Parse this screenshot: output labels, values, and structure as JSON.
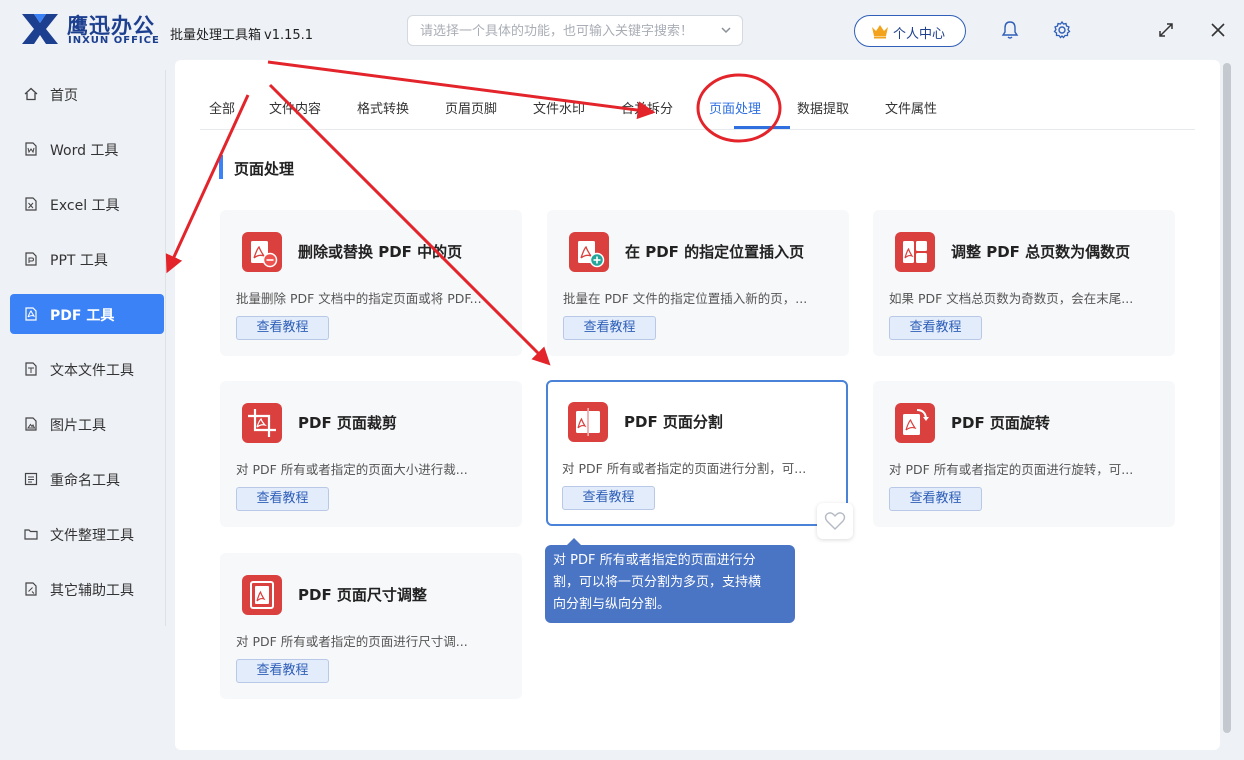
{
  "brand": {
    "name_cn": "鹰迅办公",
    "name_en": "INXUN OFFICE"
  },
  "app": {
    "title": "批量处理工具箱",
    "version": "v1.15.1"
  },
  "search": {
    "placeholder": "请选择一个具体的功能，也可输入关键字搜索！"
  },
  "header": {
    "user_center": "个人中心"
  },
  "sidebar": {
    "items": [
      {
        "label": "首页",
        "icon": "home-icon"
      },
      {
        "label": "Word 工具",
        "icon": "word-file-icon"
      },
      {
        "label": "Excel 工具",
        "icon": "excel-file-icon"
      },
      {
        "label": "PPT 工具",
        "icon": "ppt-file-icon"
      },
      {
        "label": "PDF 工具",
        "icon": "pdf-file-icon",
        "active": true
      },
      {
        "label": "文本文件工具",
        "icon": "text-file-icon"
      },
      {
        "label": "图片工具",
        "icon": "image-file-icon"
      },
      {
        "label": "重命名工具",
        "icon": "rename-icon"
      },
      {
        "label": "文件整理工具",
        "icon": "folder-icon"
      },
      {
        "label": "其它辅助工具",
        "icon": "tools-icon"
      }
    ]
  },
  "tabs": [
    {
      "label": "全部"
    },
    {
      "label": "文件内容"
    },
    {
      "label": "格式转换"
    },
    {
      "label": "页眉页脚"
    },
    {
      "label": "文件水印"
    },
    {
      "label": "合并拆分"
    },
    {
      "label": "页面处理",
      "active": true
    },
    {
      "label": "数据提取"
    },
    {
      "label": "文件属性"
    }
  ],
  "section": {
    "title": "页面处理"
  },
  "cards": [
    {
      "title": "删除或替换 PDF 中的页",
      "desc": "批量删除 PDF 文档中的指定页面或将 PDF...",
      "button": "查看教程"
    },
    {
      "title": "在 PDF 的指定位置插入页",
      "desc": "批量在 PDF 文件的指定位置插入新的页，...",
      "button": "查看教程"
    },
    {
      "title": "调整 PDF 总页数为偶数页",
      "desc": "如果 PDF 文档总页数为奇数页，会在末尾...",
      "button": "查看教程"
    },
    {
      "title": "PDF 页面裁剪",
      "desc": "对 PDF 所有或者指定的页面大小进行裁...",
      "button": "查看教程"
    },
    {
      "title": "PDF 页面分割",
      "desc": "对 PDF 所有或者指定的页面进行分割，可...",
      "button": "查看教程"
    },
    {
      "title": "PDF 页面旋转",
      "desc": "对 PDF 所有或者指定的页面进行旋转，可...",
      "button": "查看教程"
    },
    {
      "title": "PDF 页面尺寸调整",
      "desc": "对 PDF 所有或者指定的页面进行尺寸调...",
      "button": "查看教程"
    }
  ],
  "tooltip": {
    "lines": [
      "对 PDF 所有或者指定的页面进行分",
      "割，可以将一页分割为多页，支持横",
      "向分割与纵向分割。"
    ]
  },
  "colors": {
    "accent": "#3b82f6",
    "brand": "#1d3f8f",
    "pdf_red": "#d9403e",
    "annotation_red": "#e3242b",
    "tooltip_bg": "#4a74c4"
  }
}
